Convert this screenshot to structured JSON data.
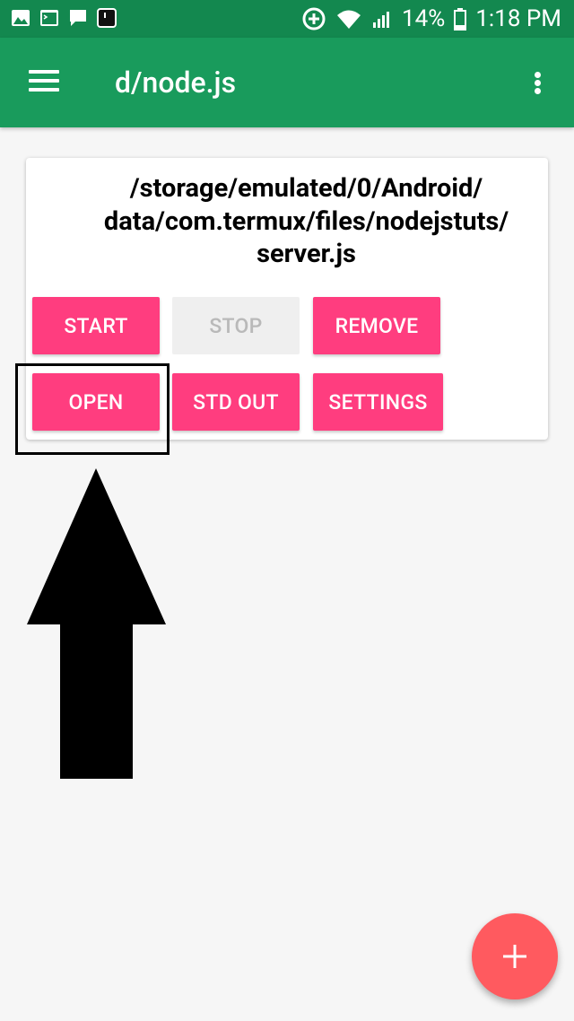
{
  "status_bar": {
    "battery": "14%",
    "time": "1:18 PM",
    "icons": [
      "image-icon",
      "terminal-icon",
      "chat-icon",
      "notification-icon",
      "data-saver-icon",
      "wifi-icon",
      "signal-icon",
      "battery-icon"
    ]
  },
  "app_bar": {
    "title": "d/node.js",
    "icons": [
      "menu-icon",
      "more-vert-icon"
    ]
  },
  "card": {
    "path_lines": [
      "/storage/emulated/0/Android/",
      "data/com.termux/files/nodejstuts/",
      "server.js"
    ],
    "buttons": {
      "start": "START",
      "stop": "STOP",
      "remove": "REMOVE",
      "open": "OPEN",
      "std_out": "STD OUT",
      "settings": "SETTINGS"
    }
  },
  "fab": {
    "icon": "plus-icon"
  },
  "colors": {
    "status_bar": "#13884f",
    "app_bar": "#199b5c",
    "button": "#ff3d7f",
    "button_disabled": "#efefef",
    "fab": "#ff5a5f"
  }
}
